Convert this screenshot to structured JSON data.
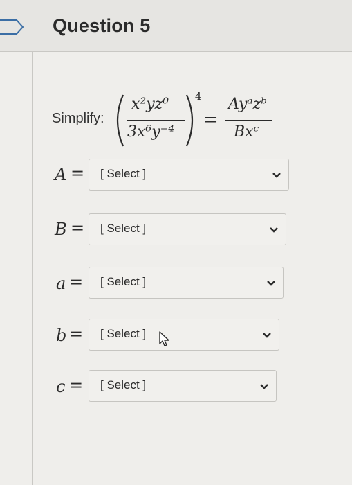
{
  "question": {
    "title": "Question 5",
    "prompt_label": "Simplify:"
  },
  "expression": {
    "lhs_numerator": "x²yz⁰",
    "lhs_denominator": "3x⁶y⁻⁴",
    "outer_exponent": "4",
    "equals": "=",
    "rhs_numerator": "Ayᵃzᵇ",
    "rhs_denominator": "Bxᶜ"
  },
  "answers": [
    {
      "variable": "A",
      "equals": "=",
      "value": "[ Select ]"
    },
    {
      "variable": "B",
      "equals": "=",
      "value": "[ Select ]"
    },
    {
      "variable": "a",
      "equals": "=",
      "value": "[ Select ]"
    },
    {
      "variable": "b",
      "equals": "=",
      "value": "[ Select ]"
    },
    {
      "variable": "c",
      "equals": "=",
      "value": "[ Select ]"
    }
  ],
  "icons": {
    "header_flag": "bookmark-flag-icon",
    "dropdown": "chevron-down-icon",
    "pointer": "mouse-cursor-icon"
  },
  "colors": {
    "page_bg": "#efeeeb",
    "header_bg": "#e6e5e2",
    "border": "#c9c8c4",
    "select_bg": "#f1f0ed",
    "text": "#2b2b2b"
  }
}
